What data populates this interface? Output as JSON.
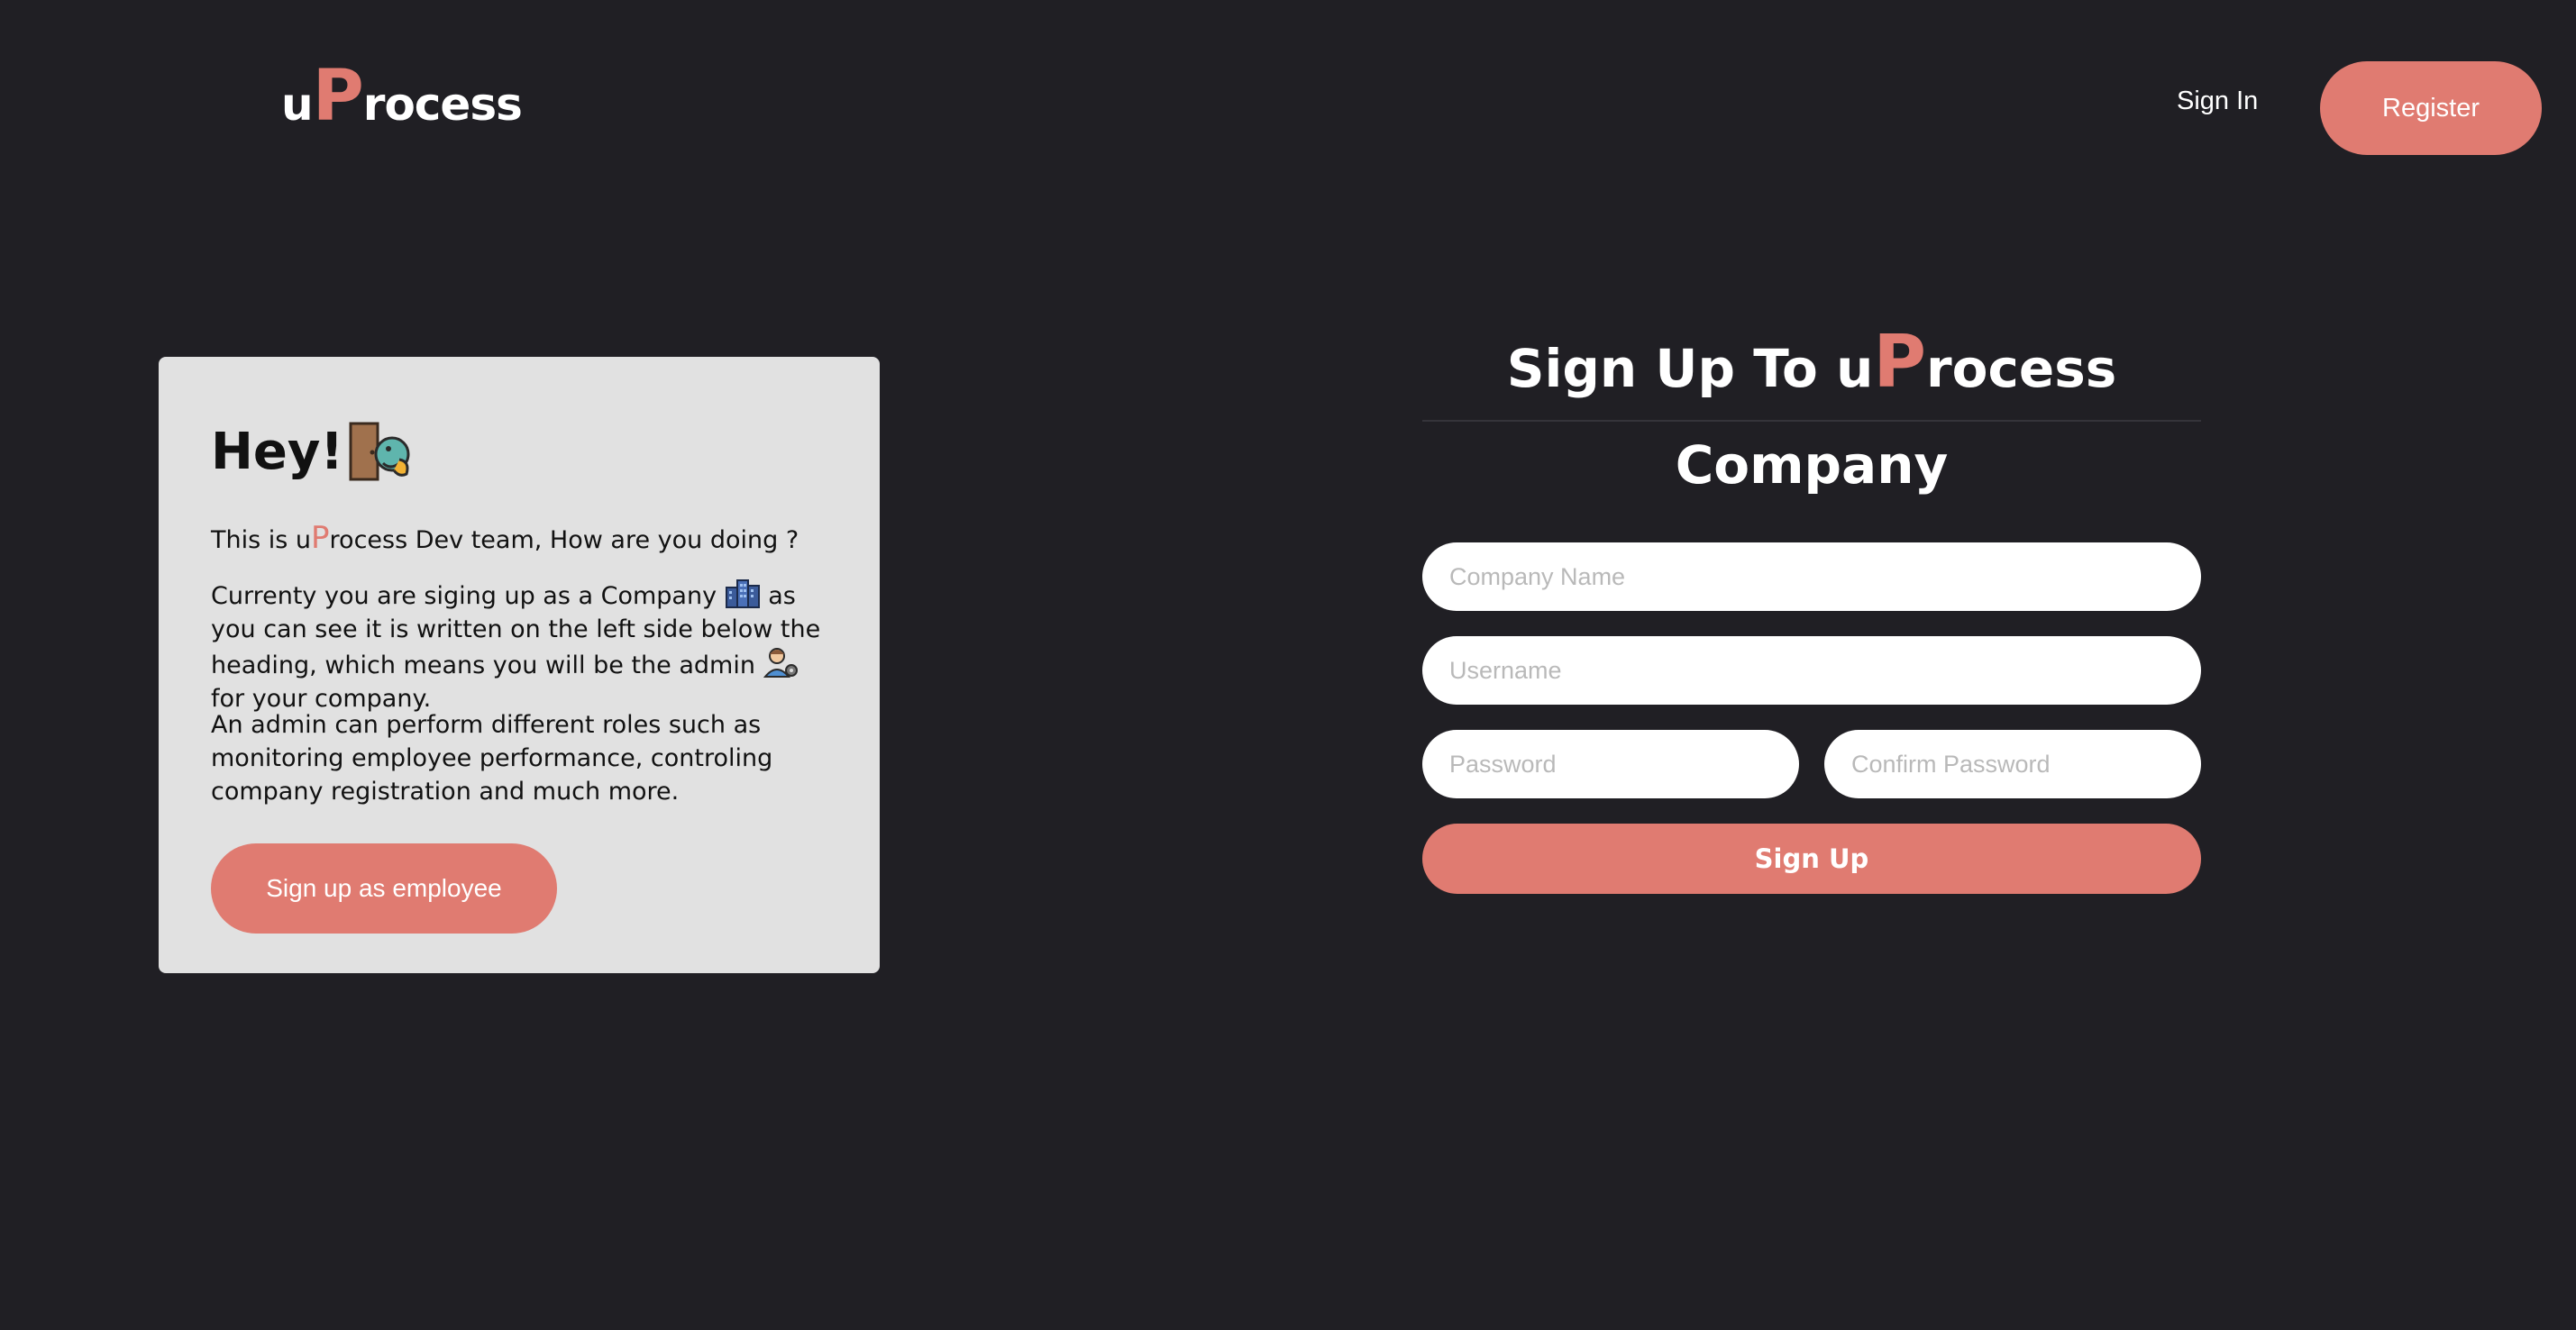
{
  "header": {
    "logo": {
      "prefix": "u",
      "accent": "P",
      "suffix": "rocess"
    },
    "nav": {
      "signin_label": "Sign In",
      "register_label": "Register"
    }
  },
  "info_card": {
    "heading": "Hey!",
    "heading_icon": "door-peek-icon",
    "intro": {
      "before": "This is u",
      "accent": "P",
      "after": "rocess Dev team, How are you doing ?"
    },
    "paragraph2": {
      "part1": "Currenty you are siging up as a Company",
      "icon1": "office-building-icon",
      "part2": "as you can see it is written on the left side below the heading, which means you will be the admin",
      "icon2": "admin-technologist-icon",
      "part3": "for your company."
    },
    "paragraph3": "An admin can perform different roles such as monitoring employee performance, controling company registration and much more.",
    "employee_button_label": "Sign up as employee"
  },
  "signup_form": {
    "title": {
      "prefix": "Sign Up To u",
      "accent": "P",
      "suffix": "rocess"
    },
    "subtitle": "Company",
    "company_name": {
      "placeholder": "Company Name",
      "value": ""
    },
    "username": {
      "placeholder": "Username",
      "value": ""
    },
    "password": {
      "placeholder": "Password",
      "value": ""
    },
    "confirm_password": {
      "placeholder": "Confirm Password",
      "value": ""
    },
    "submit_label": "Sign Up"
  },
  "colors": {
    "background": "#201f24",
    "accent": "#e07b71",
    "card": "#e1e1e1",
    "text_light": "#ffffff"
  }
}
